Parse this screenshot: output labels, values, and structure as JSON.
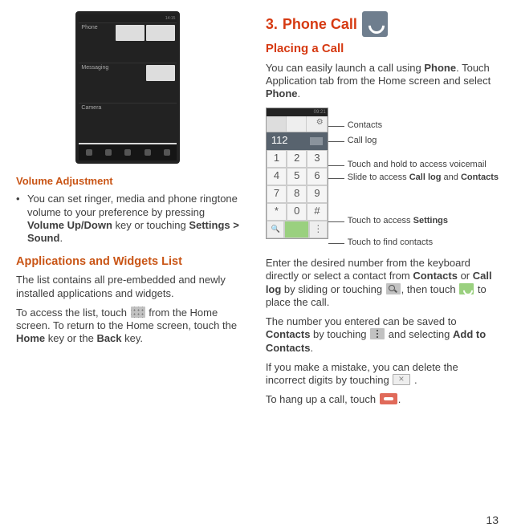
{
  "page_number": "13",
  "left": {
    "screenshot": {
      "statusbar_time": "14:15",
      "rows": [
        "Phone",
        "Messaging",
        "Camera"
      ]
    },
    "volume_heading": "Volume Adjustment",
    "volume_bullet_pre": "You can set ringer, media and phone ringtone volume to your preference by pressing ",
    "volume_bullet_bold1": "Volume Up/Down",
    "volume_bullet_mid": " key or touching ",
    "volume_bullet_bold2": "Settings > Sound",
    "volume_bullet_post": ".",
    "apps_heading": "Applications and Widgets List",
    "apps_p1": "The list contains all pre-embedded and newly installed applications and widgets.",
    "apps_p2_pre": "To access the list, touch ",
    "apps_p2_post": " from the Home screen. To return to the Home screen, touch the ",
    "apps_p2_bold1": "Home",
    "apps_p2_mid": " key or the ",
    "apps_p2_bold2": "Back",
    "apps_p2_end": " key."
  },
  "right": {
    "chapter_num": "3.",
    "chapter_title": "Phone Call",
    "placing_heading": "Placing a Call",
    "intro_pre": "You can easily launch a call using ",
    "intro_bold1": "Phone",
    "intro_mid": ". Touch Application tab from the Home screen and select ",
    "intro_bold2": "Phone",
    "intro_post": ".",
    "dialer": {
      "statusbar_time": "09:21",
      "display_number": "112",
      "keys": [
        "1",
        "2",
        "3",
        "4",
        "5",
        "6",
        "7",
        "8",
        "9",
        "*",
        "0",
        "#"
      ]
    },
    "callouts": {
      "contacts": "Contacts",
      "calllog": "Call log",
      "voicemail": "Touch and hold to access voicemail",
      "slide_pre": "Slide to access ",
      "slide_b1": "Call log",
      "slide_mid": " and ",
      "slide_b2": "Contacts",
      "settings_pre": "Touch to access ",
      "settings_b": "Settings",
      "find": "Touch to find contacts"
    },
    "p_enter_pre": "Enter the desired number from the keyboard directly or select a contact from ",
    "p_enter_b1": "Contacts",
    "p_enter_or": " or ",
    "p_enter_b2": "Call log",
    "p_enter_mid": " by sliding or touching ",
    "p_enter_mid2": ", then touch ",
    "p_enter_post": " to place the call.",
    "p_save_pre": "The number you entered can be saved to ",
    "p_save_b1": "Contacts",
    "p_save_mid": " by touching ",
    "p_save_mid2": " and selecting ",
    "p_save_b2": "Add to Contacts",
    "p_save_post": ".",
    "p_del_pre": "If you make a mistake, you can delete the incorrect digits by touching ",
    "p_del_post": " .",
    "p_hang_pre": "To hang up a call, touch ",
    "p_hang_post": "."
  }
}
